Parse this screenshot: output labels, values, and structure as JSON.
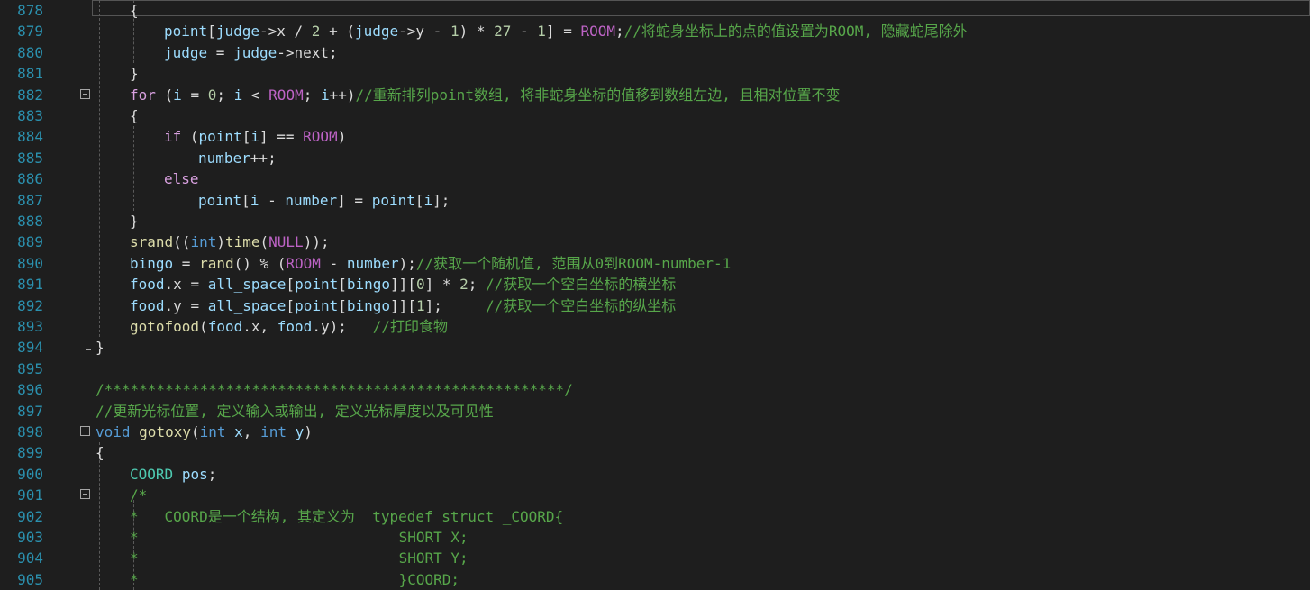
{
  "editor": {
    "language": "C",
    "colors": {
      "background": "#1e1e1e",
      "line_number": "#2b91af",
      "keyword": "#569cd6",
      "control_keyword": "#d8a0df",
      "comment": "#57a64a",
      "macro": "#bd63c5",
      "function": "#dcdcaa",
      "variable": "#9cdcfe",
      "number": "#b5cea8",
      "text": "#dcdcdc"
    },
    "lines": [
      {
        "n": "878",
        "tokens": [
          [
            "pl",
            "{"
          ]
        ]
      },
      {
        "n": "879",
        "tokens": [
          [
            "var",
            "point"
          ],
          [
            "pl",
            "["
          ],
          [
            "var",
            "judge"
          ],
          [
            "pl",
            "->"
          ],
          [
            "mem",
            "x"
          ],
          [
            "pl",
            " / "
          ],
          [
            "num",
            "2"
          ],
          [
            "pl",
            " + ("
          ],
          [
            "var",
            "judge"
          ],
          [
            "pl",
            "->"
          ],
          [
            "mem",
            "y"
          ],
          [
            "pl",
            " - "
          ],
          [
            "num",
            "1"
          ],
          [
            "pl",
            ") * "
          ],
          [
            "num",
            "27"
          ],
          [
            "pl",
            " - "
          ],
          [
            "num",
            "1"
          ],
          [
            "pl",
            "] = "
          ],
          [
            "mac",
            "ROOM"
          ],
          [
            "pl",
            ";"
          ],
          [
            "cm",
            "//将蛇身坐标上的点的值设置为ROOM, 隐藏蛇尾除外"
          ]
        ]
      },
      {
        "n": "880",
        "tokens": [
          [
            "var",
            "judge"
          ],
          [
            "pl",
            " = "
          ],
          [
            "var",
            "judge"
          ],
          [
            "pl",
            "->"
          ],
          [
            "mem",
            "next"
          ],
          [
            "pl",
            ";"
          ]
        ]
      },
      {
        "n": "881",
        "tokens": [
          [
            "pl",
            "}"
          ]
        ]
      },
      {
        "n": "882",
        "tokens": [
          [
            "kw2",
            "for"
          ],
          [
            "pl",
            " ("
          ],
          [
            "var",
            "i"
          ],
          [
            "pl",
            " = "
          ],
          [
            "num",
            "0"
          ],
          [
            "pl",
            "; "
          ],
          [
            "var",
            "i"
          ],
          [
            "pl",
            " < "
          ],
          [
            "mac",
            "ROOM"
          ],
          [
            "pl",
            "; "
          ],
          [
            "var",
            "i"
          ],
          [
            "pl",
            "++)"
          ],
          [
            "cm",
            "//重新排列point数组, 将非蛇身坐标的值移到数组左边, 且相对位置不变"
          ]
        ]
      },
      {
        "n": "883",
        "tokens": [
          [
            "pl",
            "{"
          ]
        ]
      },
      {
        "n": "884",
        "tokens": [
          [
            "kw2",
            "if"
          ],
          [
            "pl",
            " ("
          ],
          [
            "var",
            "point"
          ],
          [
            "pl",
            "["
          ],
          [
            "var",
            "i"
          ],
          [
            "pl",
            "] == "
          ],
          [
            "mac",
            "ROOM"
          ],
          [
            "pl",
            ")"
          ]
        ]
      },
      {
        "n": "885",
        "tokens": [
          [
            "var",
            "number"
          ],
          [
            "pl",
            "++;"
          ]
        ]
      },
      {
        "n": "886",
        "tokens": [
          [
            "kw2",
            "else"
          ]
        ]
      },
      {
        "n": "887",
        "tokens": [
          [
            "var",
            "point"
          ],
          [
            "pl",
            "["
          ],
          [
            "var",
            "i"
          ],
          [
            "pl",
            " - "
          ],
          [
            "var",
            "number"
          ],
          [
            "pl",
            "] = "
          ],
          [
            "var",
            "point"
          ],
          [
            "pl",
            "["
          ],
          [
            "var",
            "i"
          ],
          [
            "pl",
            "];"
          ]
        ]
      },
      {
        "n": "888",
        "tokens": [
          [
            "pl",
            "}"
          ]
        ]
      },
      {
        "n": "889",
        "tokens": [
          [
            "fn",
            "srand"
          ],
          [
            "pl",
            "(("
          ],
          [
            "kw",
            "int"
          ],
          [
            "pl",
            ")"
          ],
          [
            "fn",
            "time"
          ],
          [
            "pl",
            "("
          ],
          [
            "mac",
            "NULL"
          ],
          [
            "pl",
            "));"
          ]
        ]
      },
      {
        "n": "890",
        "tokens": [
          [
            "var",
            "bingo"
          ],
          [
            "pl",
            " = "
          ],
          [
            "fn",
            "rand"
          ],
          [
            "pl",
            "() % ("
          ],
          [
            "mac",
            "ROOM"
          ],
          [
            "pl",
            " - "
          ],
          [
            "var",
            "number"
          ],
          [
            "pl",
            ");"
          ],
          [
            "cm",
            "//获取一个随机值, 范围从0到ROOM-number-1"
          ]
        ]
      },
      {
        "n": "891",
        "tokens": [
          [
            "var",
            "food"
          ],
          [
            "pl",
            "."
          ],
          [
            "mem",
            "x"
          ],
          [
            "pl",
            " = "
          ],
          [
            "var",
            "all_space"
          ],
          [
            "pl",
            "["
          ],
          [
            "var",
            "point"
          ],
          [
            "pl",
            "["
          ],
          [
            "var",
            "bingo"
          ],
          [
            "pl",
            "]]["
          ],
          [
            "num",
            "0"
          ],
          [
            "pl",
            "] * "
          ],
          [
            "num",
            "2"
          ],
          [
            "pl",
            "; "
          ],
          [
            "cm",
            "//获取一个空白坐标的横坐标"
          ]
        ]
      },
      {
        "n": "892",
        "tokens": [
          [
            "var",
            "food"
          ],
          [
            "pl",
            "."
          ],
          [
            "mem",
            "y"
          ],
          [
            "pl",
            " = "
          ],
          [
            "var",
            "all_space"
          ],
          [
            "pl",
            "["
          ],
          [
            "var",
            "point"
          ],
          [
            "pl",
            "["
          ],
          [
            "var",
            "bingo"
          ],
          [
            "pl",
            "]]["
          ],
          [
            "num",
            "1"
          ],
          [
            "pl",
            "];     "
          ],
          [
            "cm",
            "//获取一个空白坐标的纵坐标"
          ]
        ]
      },
      {
        "n": "893",
        "tokens": [
          [
            "fn",
            "gotofood"
          ],
          [
            "pl",
            "("
          ],
          [
            "var",
            "food"
          ],
          [
            "pl",
            "."
          ],
          [
            "mem",
            "x"
          ],
          [
            "pl",
            ", "
          ],
          [
            "var",
            "food"
          ],
          [
            "pl",
            "."
          ],
          [
            "mem",
            "y"
          ],
          [
            "pl",
            ");   "
          ],
          [
            "cm",
            "//打印食物"
          ]
        ]
      },
      {
        "n": "894",
        "tokens": [
          [
            "pl",
            "}"
          ]
        ]
      },
      {
        "n": "895",
        "tokens": []
      },
      {
        "n": "896",
        "tokens": [
          [
            "cm",
            "/*****************************************************/"
          ]
        ]
      },
      {
        "n": "897",
        "tokens": [
          [
            "cm",
            "//更新光标位置, 定义输入或输出, 定义光标厚度以及可见性"
          ]
        ]
      },
      {
        "n": "898",
        "tokens": [
          [
            "kw",
            "void"
          ],
          [
            "pl",
            " "
          ],
          [
            "fn",
            "gotoxy"
          ],
          [
            "pl",
            "("
          ],
          [
            "kw",
            "int"
          ],
          [
            "pl",
            " "
          ],
          [
            "var",
            "x"
          ],
          [
            "pl",
            ", "
          ],
          [
            "kw",
            "int"
          ],
          [
            "pl",
            " "
          ],
          [
            "var",
            "y"
          ],
          [
            "pl",
            ")"
          ]
        ]
      },
      {
        "n": "899",
        "tokens": [
          [
            "pl",
            "{"
          ]
        ]
      },
      {
        "n": "900",
        "tokens": [
          [
            "ty",
            "COORD"
          ],
          [
            "pl",
            " "
          ],
          [
            "var",
            "pos"
          ],
          [
            "pl",
            ";"
          ]
        ]
      },
      {
        "n": "901",
        "tokens": [
          [
            "cm",
            "/*"
          ]
        ]
      },
      {
        "n": "902",
        "tokens": [
          [
            "cm",
            "*   COORD是一个结构, 其定义为  typedef struct _COORD{"
          ]
        ]
      },
      {
        "n": "903",
        "tokens": [
          [
            "cm",
            "*                              SHORT X;"
          ]
        ]
      },
      {
        "n": "904",
        "tokens": [
          [
            "cm",
            "*                              SHORT Y;"
          ]
        ]
      },
      {
        "n": "905",
        "tokens": [
          [
            "cm",
            "*                              }COORD;"
          ]
        ]
      }
    ]
  }
}
